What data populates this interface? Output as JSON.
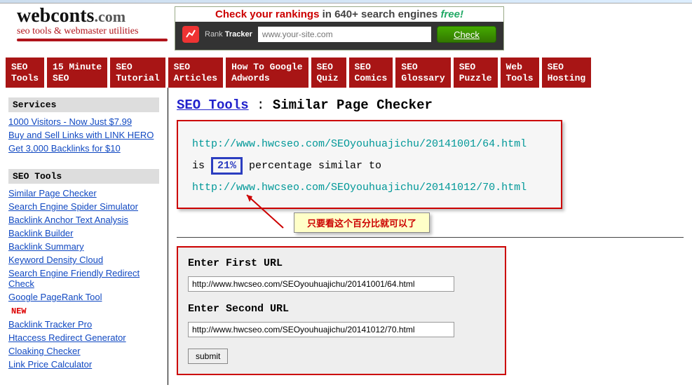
{
  "logo": {
    "main": "webconts",
    "ext": ".com",
    "sub": "seo tools & webmaster utilities"
  },
  "checker": {
    "top_red": "Check your rankings",
    "top_mid": " in 640+ search engines ",
    "top_green": "free!",
    "rank_label1": "Rank",
    "rank_label2": "Tracker",
    "placeholder": "www.your-site.com",
    "button": "Check"
  },
  "nav": [
    "SEO\nTools",
    "15 Minute\nSEO",
    "SEO\nTutorial",
    "SEO\nArticles",
    "How To Google\nAdwords",
    "SEO\nQuiz",
    "SEO\nComics",
    "SEO\nGlossary",
    "SEO\nPuzzle",
    "Web\nTools",
    "SEO\nHosting"
  ],
  "sidebar": {
    "services_header": "Services",
    "services": [
      "1000 Visitors - Now Just $7.99",
      "Buy and Sell Links with LINK HERO",
      "Get 3,000 Backlinks for $10"
    ],
    "tools_header": "SEO Tools",
    "tools": [
      {
        "label": "Similar Page Checker",
        "new": false
      },
      {
        "label": "Search Engine Spider Simulator",
        "new": false
      },
      {
        "label": "Backlink Anchor Text Analysis",
        "new": false
      },
      {
        "label": "Backlink Builder",
        "new": false
      },
      {
        "label": "Backlink Summary",
        "new": false
      },
      {
        "label": "Keyword Density Cloud",
        "new": false
      },
      {
        "label": "Search Engine Friendly Redirect Check",
        "new": false
      },
      {
        "label": "Google PageRank Tool",
        "new": true
      },
      {
        "label": "Backlink Tracker Pro",
        "new": false
      },
      {
        "label": "Htaccess Redirect Generator",
        "new": false
      },
      {
        "label": "Cloaking Checker",
        "new": false
      },
      {
        "label": "Link Price Calculator",
        "new": false
      }
    ],
    "new_tag": "NEW"
  },
  "page": {
    "title_link": "SEO Tools",
    "title_sep": " : ",
    "title_rest": "Similar Page Checker",
    "url1": "http://www.hwcseo.com/SEOyouhuajichu/20141001/64.html",
    "line_is": "is ",
    "pct": "21%",
    "line_rest": " percentage similar to",
    "url2": "http://www.hwcseo.com/SEOyouhuajichu/20141012/70.html",
    "callout": "只要看这个百分比就可以了"
  },
  "form": {
    "label1": "Enter First URL",
    "value1": "http://www.hwcseo.com/SEOyouhuajichu/20141001/64.html",
    "label2": "Enter Second URL",
    "value2": "http://www.hwcseo.com/SEOyouhuajichu/20141012/70.html",
    "submit": "submit"
  }
}
